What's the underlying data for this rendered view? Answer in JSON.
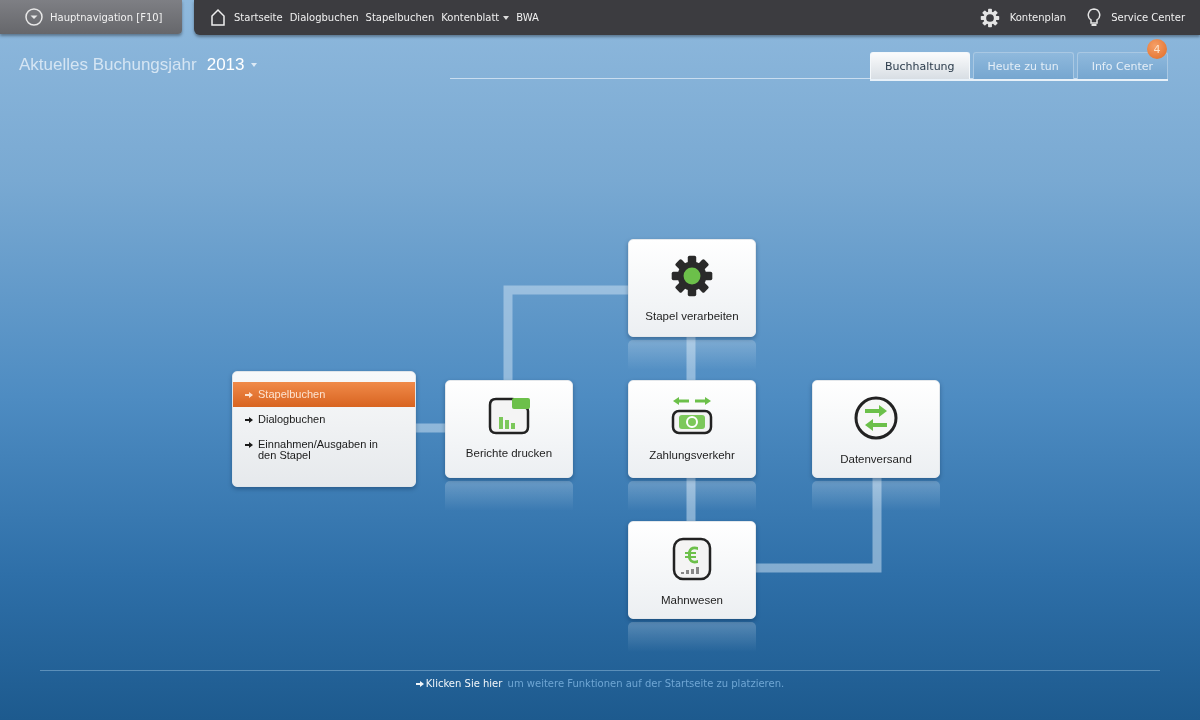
{
  "top_nav": {
    "main_button": "Hauptnavigation [F10]",
    "links": [
      {
        "label": "Startseite",
        "dropdown": false
      },
      {
        "label": "Dialogbuchen",
        "dropdown": false
      },
      {
        "label": "Stapelbuchen",
        "dropdown": false
      },
      {
        "label": "Kontenblatt",
        "dropdown": true
      },
      {
        "label": "BWA",
        "dropdown": false
      }
    ],
    "right_links": [
      {
        "label": "Kontenplan",
        "kind": "gear"
      },
      {
        "label": "Service Center",
        "kind": "bulb"
      }
    ]
  },
  "year": {
    "label": "Aktuelles Buchungsjahr",
    "value": "2013"
  },
  "tabs": [
    {
      "label": "Buchhaltung",
      "selected": true
    },
    {
      "label": "Heute zu tun",
      "selected": false
    },
    {
      "label": "Info Center",
      "selected": false,
      "badge": "4"
    }
  ],
  "menu": {
    "items": [
      {
        "label": "Stapelbuchen",
        "selected": true
      },
      {
        "label": "Dialogbuchen",
        "selected": false
      },
      {
        "label": "Einnahmen/Ausgaben in den Stapel",
        "selected": false
      }
    ]
  },
  "cards": [
    {
      "label": "Stapel verarbeiten",
      "kind": "gear"
    },
    {
      "label": "Berichte drucken",
      "kind": "report"
    },
    {
      "label": "Zahlungsverkehr",
      "kind": "payment"
    },
    {
      "label": "Datenversand",
      "kind": "exchange"
    },
    {
      "label": "Mahnwesen",
      "kind": "reminder"
    }
  ],
  "footer": {
    "link": "Klicken Sie hier",
    "text": "um weitere Funktionen auf der Startseite zu platzieren."
  }
}
